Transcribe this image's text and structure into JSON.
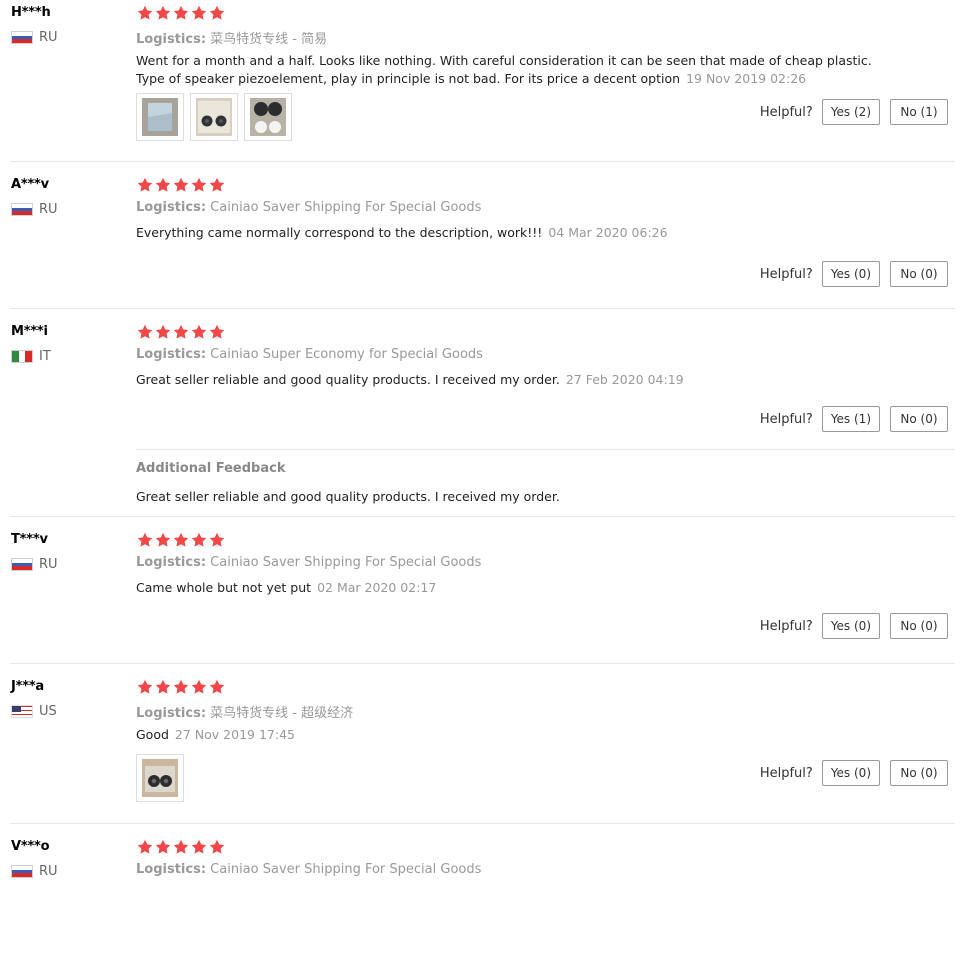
{
  "labels": {
    "logistics": "Logistics:",
    "helpful": "Helpful?",
    "additional_feedback": "Additional Feedback"
  },
  "colors": {
    "star": "#f04848",
    "muted_text": "#999999",
    "border": "#e8e8e8"
  },
  "reviews": [
    {
      "user": "H***h",
      "country": "RU",
      "rating": 5,
      "logistics": "菜鸟特货专线 - 简易",
      "text_lines": [
        "Went for a month and a half. Looks like nothing. With careful consideration it can be seen that made of cheap plastic.",
        "Type of speaker piezoelement, play in principle is not bad. For its price a decent option"
      ],
      "date": "19 Nov 2019 02:26",
      "photos": [
        "photo-package",
        "photo-two-speakers",
        "photo-speakers-and-pads"
      ],
      "yes": "Yes (2)",
      "no": "No (1)"
    },
    {
      "user": "A***v",
      "country": "RU",
      "rating": 5,
      "logistics": "Cainiao Saver Shipping For Special Goods",
      "text_lines": [
        "Everything came normally correspond to the description, work!!!"
      ],
      "date": "04 Mar 2020 06:26",
      "yes": "Yes (0)",
      "no": "No (0)"
    },
    {
      "user": "M***i",
      "country": "IT",
      "rating": 5,
      "logistics": "Cainiao Super Economy for Special Goods",
      "text_lines": [
        "Great seller reliable and good quality products. I received my order."
      ],
      "date": "27 Feb 2020 04:19",
      "yes": "Yes (1)",
      "no": "No (0)",
      "additional_feedback": "Great seller reliable and good quality products. I received my order."
    },
    {
      "user": "T***v",
      "country": "RU",
      "rating": 5,
      "logistics": "Cainiao Saver Shipping For Special Goods",
      "text_lines": [
        "Came whole but not yet put"
      ],
      "date": "02 Mar 2020 02:17",
      "yes": "Yes (0)",
      "no": "No (0)"
    },
    {
      "user": "J***a",
      "country": "US",
      "rating": 5,
      "logistics": "菜鸟特货专线 - 超级经济",
      "text_lines": [
        "Good"
      ],
      "date": "27 Nov 2019 17:45",
      "photos": [
        "photo-speakers-in-bag"
      ],
      "yes": "Yes (0)",
      "no": "No (0)"
    },
    {
      "user": "V***o",
      "country": "RU",
      "rating": 5,
      "logistics": "Cainiao Saver Shipping For Special Goods",
      "text_lines": [],
      "date": ""
    }
  ]
}
